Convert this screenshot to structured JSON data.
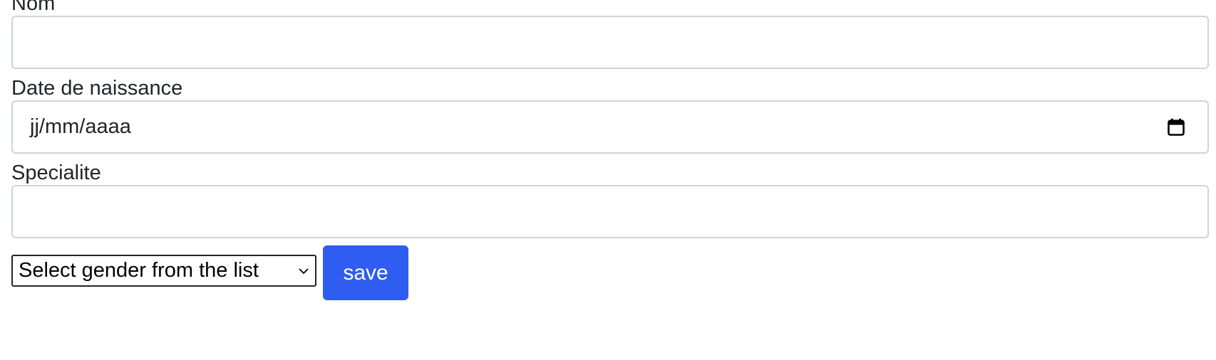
{
  "form": {
    "nom": {
      "label": "Nom",
      "value": ""
    },
    "date_naissance": {
      "label": "Date de naissance",
      "placeholder": "jj/mm/aaaa",
      "icon": "calendar-icon"
    },
    "specialite": {
      "label": "Specialite",
      "value": ""
    },
    "gender_select": {
      "selected": "Select gender from the list",
      "icon": "chevron-down-icon"
    },
    "save_label": "save"
  },
  "colors": {
    "accent": "#2f5cf1",
    "input_border": "#ced4da",
    "text": "#212529"
  }
}
